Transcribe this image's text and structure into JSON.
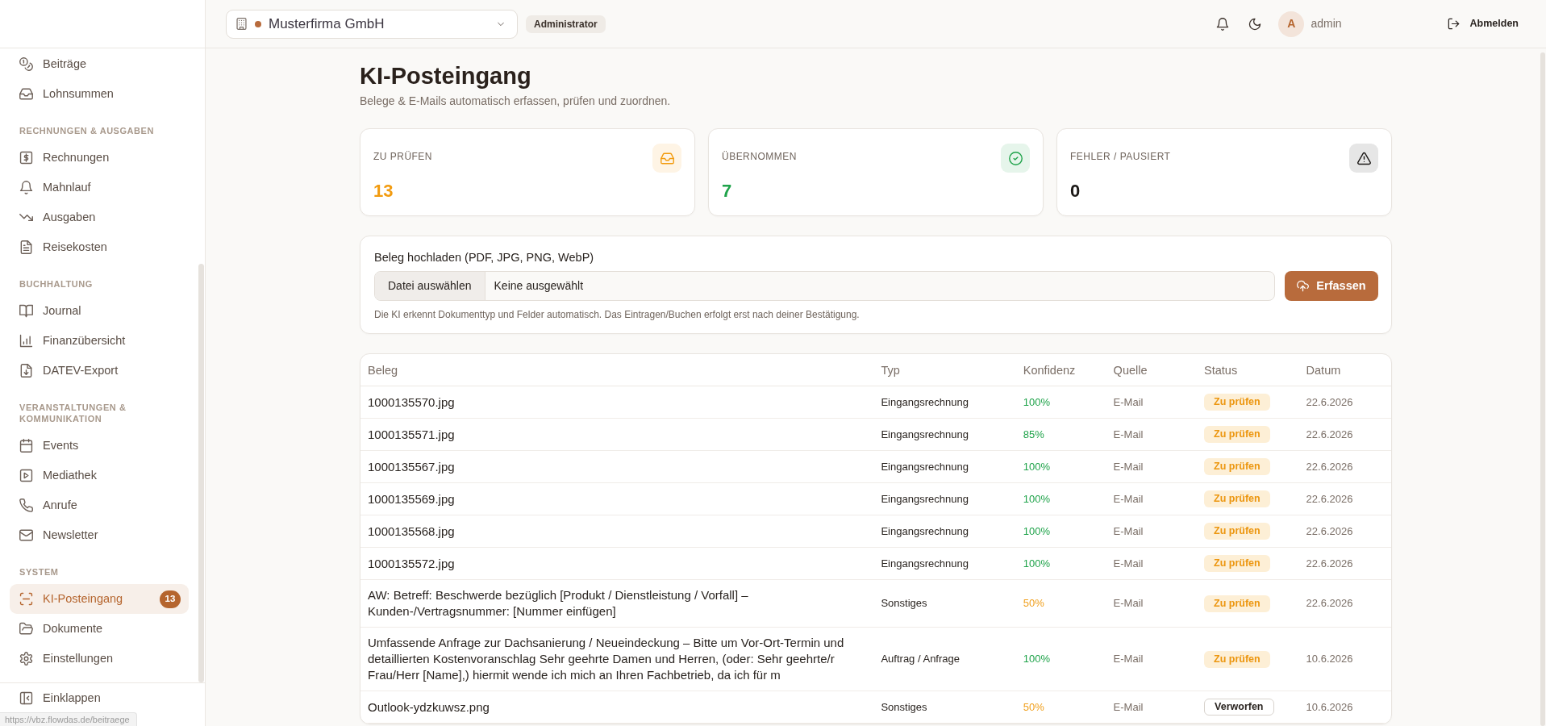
{
  "sidebar": {
    "sections": [
      {
        "items": [
          {
            "label": "Beiträge",
            "selected": false
          },
          {
            "label": "Lohnsummen",
            "selected": false
          }
        ]
      },
      {
        "title": "RECHNUNGEN & AUSGABEN",
        "items": [
          {
            "label": "Rechnungen",
            "selected": false
          },
          {
            "label": "Mahnlauf",
            "selected": false
          },
          {
            "label": "Ausgaben",
            "selected": false
          },
          {
            "label": "Reisekosten",
            "selected": false
          }
        ]
      },
      {
        "title": "BUCHHALTUNG",
        "items": [
          {
            "label": "Journal",
            "selected": false
          },
          {
            "label": "Finanzübersicht",
            "selected": false
          },
          {
            "label": "DATEV-Export",
            "selected": false
          }
        ]
      },
      {
        "title": "VERANSTALTUNGEN & KOMMUNIKATION",
        "items": [
          {
            "label": "Events",
            "selected": false
          },
          {
            "label": "Mediathek",
            "selected": false
          },
          {
            "label": "Anrufe",
            "selected": false
          },
          {
            "label": "Newsletter",
            "selected": false
          }
        ]
      },
      {
        "title": "SYSTEM",
        "items": [
          {
            "label": "KI-Posteingang",
            "selected": true,
            "badge": "13"
          },
          {
            "label": "Dokumente",
            "selected": false
          },
          {
            "label": "Einstellungen",
            "selected": false
          }
        ]
      }
    ],
    "collapse": "Einklappen"
  },
  "browser_status": {
    "url": "https://vbz.flowdas.de/beitraege"
  },
  "header": {
    "company": "Musterfirma GmbH",
    "role": "Administrator",
    "avatar_initial": "A",
    "user_name": "admin",
    "logout": "Abmelden"
  },
  "page": {
    "title": "KI-Posteingang",
    "subtitle": "Belege & E-Mails automatisch erfassen, prüfen und zuordnen."
  },
  "stats": [
    {
      "label": "ZU PRÜFEN",
      "value": "13",
      "color": "#f29b0f"
    },
    {
      "label": "ÜBERNOMMEN",
      "value": "7",
      "color": "#1fa34a"
    },
    {
      "label": "FEHLER / PAUSIERT",
      "value": "0",
      "color": "#1c1917"
    }
  ],
  "upload": {
    "label": "Beleg hochladen (PDF, JPG, PNG, WebP)",
    "file_button": "Datei auswählen",
    "file_status": "Keine ausgewählt",
    "submit": "Erfassen",
    "hint": "Die KI erkennt Dokumenttyp und Felder automatisch. Das Eintragen/Buchen erfolgt erst nach deiner Bestätigung."
  },
  "table": {
    "columns": [
      "Beleg",
      "Typ",
      "Konfidenz",
      "Quelle",
      "Status",
      "Datum"
    ],
    "rows": [
      {
        "document": "1000135570.jpg",
        "type": "Eingangsrechnung",
        "confidence": {
          "text": "100%",
          "color": "#1fa34a"
        },
        "source": "E-Mail",
        "status": {
          "label": "Zu prüfen",
          "kind": "review"
        },
        "date": "22.6.2026"
      },
      {
        "document": "1000135571.jpg",
        "type": "Eingangsrechnung",
        "confidence": {
          "text": "85%",
          "color": "#1fa34a"
        },
        "source": "E-Mail",
        "status": {
          "label": "Zu prüfen",
          "kind": "review"
        },
        "date": "22.6.2026"
      },
      {
        "document": "1000135567.jpg",
        "type": "Eingangsrechnung",
        "confidence": {
          "text": "100%",
          "color": "#1fa34a"
        },
        "source": "E-Mail",
        "status": {
          "label": "Zu prüfen",
          "kind": "review"
        },
        "date": "22.6.2026"
      },
      {
        "document": "1000135569.jpg",
        "type": "Eingangsrechnung",
        "confidence": {
          "text": "100%",
          "color": "#1fa34a"
        },
        "source": "E-Mail",
        "status": {
          "label": "Zu prüfen",
          "kind": "review"
        },
        "date": "22.6.2026"
      },
      {
        "document": "1000135568.jpg",
        "type": "Eingangsrechnung",
        "confidence": {
          "text": "100%",
          "color": "#1fa34a"
        },
        "source": "E-Mail",
        "status": {
          "label": "Zu prüfen",
          "kind": "review"
        },
        "date": "22.6.2026"
      },
      {
        "document": "1000135572.jpg",
        "type": "Eingangsrechnung",
        "confidence": {
          "text": "100%",
          "color": "#1fa34a"
        },
        "source": "E-Mail",
        "status": {
          "label": "Zu prüfen",
          "kind": "review"
        },
        "date": "22.6.2026"
      },
      {
        "document": "AW: Betreff: Beschwerde bezüglich [Produkt / Dienstleistung / Vorfall] – Kunden-/Vertragsnummer: [Nummer einfügen]",
        "type": "Sonstiges",
        "confidence": {
          "text": "50%",
          "color": "#f0a01e"
        },
        "source": "E-Mail",
        "status": {
          "label": "Zu prüfen",
          "kind": "review"
        },
        "date": "22.6.2026"
      },
      {
        "document": "Umfassende Anfrage zur Dachsanierung / Neueindeckung – Bitte um Vor-Ort-Termin und detaillierten Kostenvoranschlag Sehr geehrte Damen und Herren, (oder: Sehr geehrte/r Frau/Herr [Name],) hiermit wende ich mich an Ihren Fachbetrieb, da ich für m",
        "type": "Auftrag / Anfrage",
        "confidence": {
          "text": "100%",
          "color": "#1fa34a"
        },
        "source": "E-Mail",
        "status": {
          "label": "Zu prüfen",
          "kind": "review"
        },
        "date": "10.6.2026"
      },
      {
        "document": "Outlook-ydzkuwsz.png",
        "type": "Sonstiges",
        "confidence": {
          "text": "50%",
          "color": "#f0a01e"
        },
        "source": "E-Mail",
        "status": {
          "label": "Verworfen",
          "kind": "discarded"
        },
        "date": "10.6.2026"
      }
    ]
  }
}
